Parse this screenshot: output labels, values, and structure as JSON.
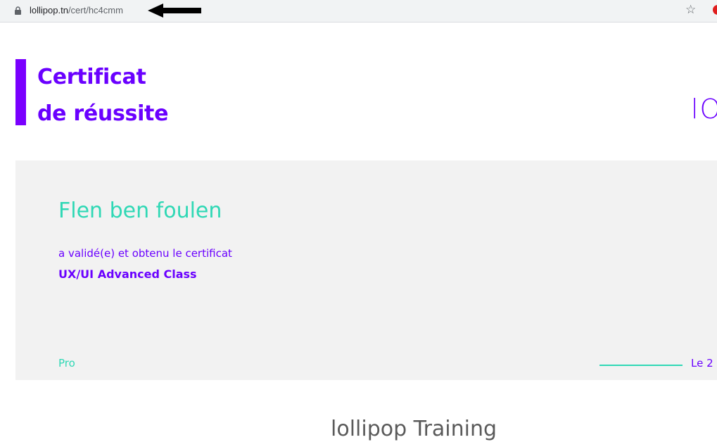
{
  "browser": {
    "url_host": "lollipop.tn",
    "url_path": "/cert/hc4cmm",
    "icons": [
      "lock-icon",
      "arrow-left-icon",
      "star-icon",
      "extension-icon"
    ],
    "star_glyph": "☆"
  },
  "certificate": {
    "title_line1": "Certificat",
    "title_line2": "de réussite",
    "logo_text": "lO",
    "recipient_name": "Flen ben foulen",
    "validated_text": "a validé(e) et obtenu le certificat",
    "course_name": "UX/UI Advanced Class",
    "level_label": "Pro",
    "date_label": "Le 2",
    "footer_partial": "lollipop Training"
  },
  "colors": {
    "accent_purple": "#6a00ff",
    "accent_bar": "#7a00ff",
    "accent_teal": "#2fd8b5",
    "card_bg": "#f2f2f2",
    "addrbar_bg": "#f1f3f4"
  }
}
